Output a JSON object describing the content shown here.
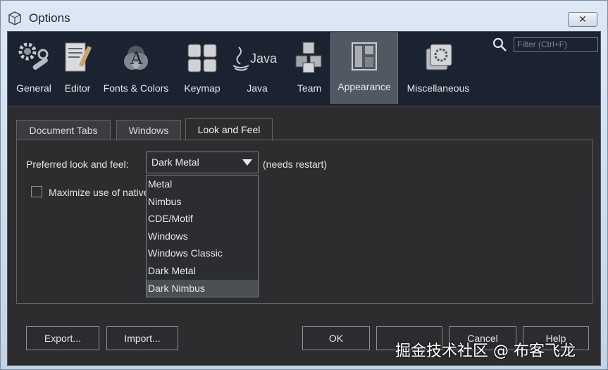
{
  "window": {
    "title": "Options",
    "close": "✕"
  },
  "categories": [
    {
      "label": "General",
      "icon": "gears-wrench-icon",
      "selected": false
    },
    {
      "label": "Editor",
      "icon": "editor-icon",
      "selected": false
    },
    {
      "label": "Fonts & Colors",
      "icon": "fonts-colors-icon",
      "selected": false
    },
    {
      "label": "Keymap",
      "icon": "keymap-icon",
      "selected": false
    },
    {
      "label": "Java",
      "icon": "java-icon",
      "selected": false
    },
    {
      "label": "Team",
      "icon": "team-cubes-icon",
      "selected": false
    },
    {
      "label": "Appearance",
      "icon": "appearance-icon",
      "selected": true
    },
    {
      "label": "Miscellaneous",
      "icon": "miscellaneous-icon",
      "selected": false
    }
  ],
  "java_logo_text": "Java",
  "filter": {
    "placeholder": "Filter (Ctrl+F)"
  },
  "tabs": [
    {
      "label": "Document Tabs",
      "active": false
    },
    {
      "label": "Windows",
      "active": false
    },
    {
      "label": "Look and Feel",
      "active": true
    }
  ],
  "look_and_feel": {
    "label": "Preferred look and feel:",
    "selected": "Dark Metal",
    "note": "(needs restart)",
    "options": [
      "Metal",
      "Nimbus",
      "CDE/Motif",
      "Windows",
      "Windows Classic",
      "Dark Metal",
      "Dark Nimbus"
    ],
    "highlighted": "Dark Nimbus"
  },
  "maximize": {
    "label": "Maximize use of native look and feel",
    "checked": false
  },
  "buttons": {
    "export": "Export...",
    "import": "Import...",
    "ok": "OK",
    "cancel": "Cancel",
    "help": "Help"
  },
  "watermark": "掘金技术社区 @ 布客飞龙"
}
